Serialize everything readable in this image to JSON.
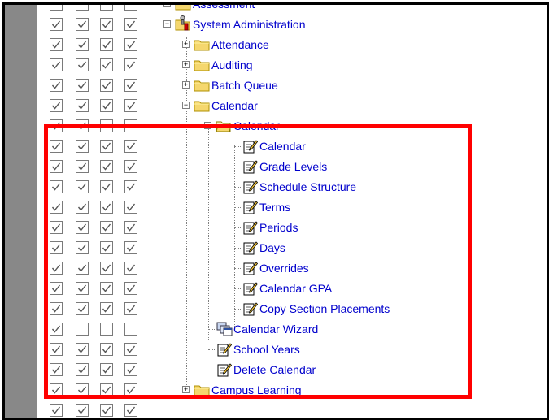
{
  "tree": {
    "assessment": "Assessment",
    "system_admin": "System Administration",
    "attendance": "Attendance",
    "auditing": "Auditing",
    "batch_queue": "Batch Queue",
    "calendar_folder": "Calendar",
    "calendar_subfolder": "Calendar",
    "items": [
      "Calendar",
      "Grade Levels",
      "Schedule Structure",
      "Terms",
      "Periods",
      "Days",
      "Overrides",
      "Calendar GPA",
      "Copy Section Placements"
    ],
    "calendar_wizard": "Calendar Wizard",
    "school_years": "School Years",
    "delete_calendar": "Delete Calendar",
    "campus_learning": "Campus Learning"
  },
  "checkbox_rows": [
    [
      false,
      false,
      false,
      false
    ],
    [
      true,
      true,
      true,
      true
    ],
    [
      true,
      true,
      true,
      true
    ],
    [
      true,
      true,
      true,
      true
    ],
    [
      true,
      true,
      true,
      true
    ],
    [
      true,
      true,
      true,
      true
    ],
    [
      true,
      true,
      false,
      false
    ],
    [
      true,
      true,
      true,
      true
    ],
    [
      true,
      true,
      true,
      true
    ],
    [
      true,
      true,
      true,
      true
    ],
    [
      true,
      true,
      true,
      true
    ],
    [
      true,
      true,
      true,
      true
    ],
    [
      true,
      true,
      true,
      true
    ],
    [
      true,
      true,
      true,
      true
    ],
    [
      true,
      true,
      true,
      true
    ],
    [
      true,
      true,
      true,
      true
    ],
    [
      true,
      false,
      false,
      false
    ],
    [
      true,
      true,
      true,
      true
    ],
    [
      true,
      true,
      true,
      true
    ],
    [
      true,
      true,
      true,
      true
    ],
    [
      true,
      true,
      true,
      true
    ]
  ],
  "colors": {
    "link": "#0000cc",
    "highlight": "#ff0000",
    "strip": "#888888",
    "folder": "#f5d76e"
  }
}
